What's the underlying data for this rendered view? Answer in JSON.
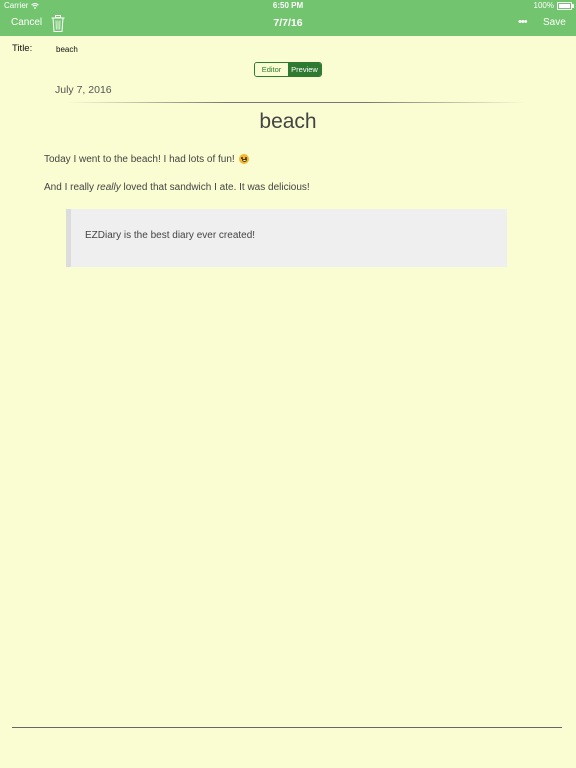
{
  "status_bar": {
    "carrier": "Carrier",
    "time": "6:50 PM",
    "battery": "100%"
  },
  "nav": {
    "cancel": "Cancel",
    "title": "7/7/16",
    "more": "•••",
    "save": "Save"
  },
  "title_field": {
    "label": "Title:",
    "value": "beach"
  },
  "mode_toggle": {
    "options": [
      "Editor",
      "Preview"
    ],
    "selected": "Preview"
  },
  "entry": {
    "date": "July 7, 2016",
    "heading": "beach",
    "paragraph1": "Today I went to the beach! I had lots of fun!",
    "paragraph2_before": "And I really ",
    "paragraph2_emphasis": "really",
    "paragraph2_after": " loved that sandwich I ate. It was delicious!",
    "blockquote": "EZDiary is the best diary ever created!"
  },
  "colors": {
    "nav_bar": "#73c46f",
    "background": "#fafdd1",
    "toggle_accent": "#2f7a31",
    "blockquote_bg": "#efefef"
  }
}
